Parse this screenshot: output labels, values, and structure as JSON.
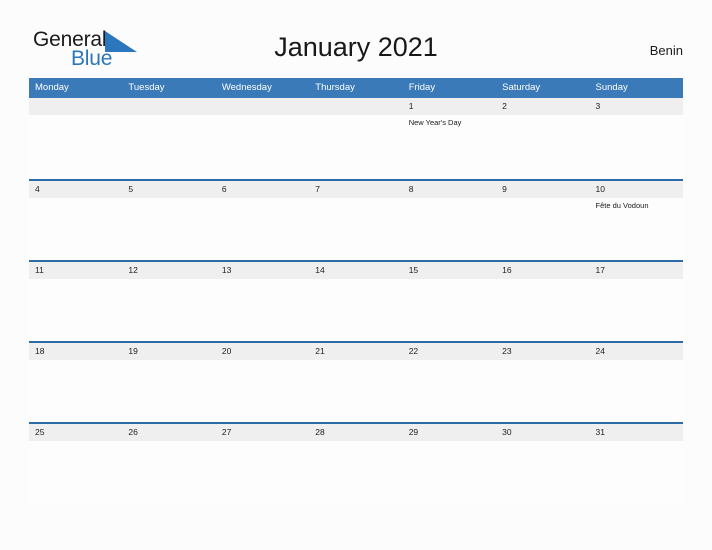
{
  "brand": {
    "name_part1": "General",
    "name_part2": "Blue",
    "logo_icon": "blue-triangle-flag",
    "color_dark": "#1b1b1b",
    "color_blue": "#2b77bd"
  },
  "header": {
    "title": "January 2021",
    "subtitle": "Benin"
  },
  "colors": {
    "header_blue": "#3a7ab8",
    "row_border_blue": "#2b6ca8",
    "day_band_gray": "#efefef",
    "page_background": "#fcfcfc"
  },
  "calendar": {
    "month": "January",
    "year": "2021",
    "weekday_headers": [
      "Monday",
      "Tuesday",
      "Wednesday",
      "Thursday",
      "Friday",
      "Saturday",
      "Sunday"
    ],
    "weeks": [
      {
        "days": [
          {
            "number": "",
            "events": []
          },
          {
            "number": "",
            "events": []
          },
          {
            "number": "",
            "events": []
          },
          {
            "number": "",
            "events": []
          },
          {
            "number": "1",
            "events": [
              "New Year's Day"
            ]
          },
          {
            "number": "2",
            "events": []
          },
          {
            "number": "3",
            "events": []
          }
        ]
      },
      {
        "days": [
          {
            "number": "4",
            "events": []
          },
          {
            "number": "5",
            "events": []
          },
          {
            "number": "6",
            "events": []
          },
          {
            "number": "7",
            "events": []
          },
          {
            "number": "8",
            "events": []
          },
          {
            "number": "9",
            "events": []
          },
          {
            "number": "10",
            "events": [
              "Fête du Vodoun"
            ]
          }
        ]
      },
      {
        "days": [
          {
            "number": "11",
            "events": []
          },
          {
            "number": "12",
            "events": []
          },
          {
            "number": "13",
            "events": []
          },
          {
            "number": "14",
            "events": []
          },
          {
            "number": "15",
            "events": []
          },
          {
            "number": "16",
            "events": []
          },
          {
            "number": "17",
            "events": []
          }
        ]
      },
      {
        "days": [
          {
            "number": "18",
            "events": []
          },
          {
            "number": "19",
            "events": []
          },
          {
            "number": "20",
            "events": []
          },
          {
            "number": "21",
            "events": []
          },
          {
            "number": "22",
            "events": []
          },
          {
            "number": "23",
            "events": []
          },
          {
            "number": "24",
            "events": []
          }
        ]
      },
      {
        "days": [
          {
            "number": "25",
            "events": []
          },
          {
            "number": "26",
            "events": []
          },
          {
            "number": "27",
            "events": []
          },
          {
            "number": "28",
            "events": []
          },
          {
            "number": "29",
            "events": []
          },
          {
            "number": "30",
            "events": []
          },
          {
            "number": "31",
            "events": []
          }
        ]
      }
    ]
  }
}
